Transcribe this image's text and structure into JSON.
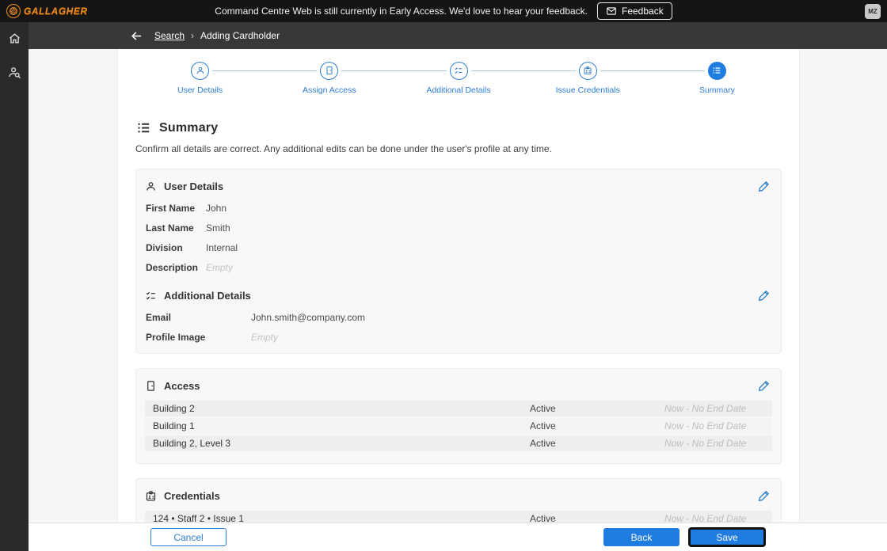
{
  "topbar": {
    "logo_text": "GALLAGHER",
    "message": "Command Centre Web is still currently in Early Access. We'd love to hear your feedback.",
    "feedback_label": "Feedback",
    "user_badge": "MZ"
  },
  "breadcrumb": {
    "back_label": "Search",
    "separator": "›",
    "current": "Adding Cardholder"
  },
  "stepper": {
    "steps": [
      {
        "label": "User Details",
        "icon": "person-icon",
        "state": "done"
      },
      {
        "label": "Assign Access",
        "icon": "door-icon",
        "state": "done"
      },
      {
        "label": "Additional Details",
        "icon": "checklist-icon",
        "state": "done"
      },
      {
        "label": "Issue Credentials",
        "icon": "id-badge-icon",
        "state": "done"
      },
      {
        "label": "Summary",
        "icon": "list-icon",
        "state": "current"
      }
    ]
  },
  "page": {
    "title": "Summary",
    "subtitle": "Confirm all details are correct. Any additional edits can be done under the user's profile at any time."
  },
  "user_details": {
    "title": "User Details",
    "fields": [
      {
        "label": "First Name",
        "value": "John"
      },
      {
        "label": "Last Name",
        "value": "Smith"
      },
      {
        "label": "Division",
        "value": "Internal"
      },
      {
        "label": "Description",
        "value": "Empty"
      }
    ]
  },
  "additional_details": {
    "title": "Additional Details",
    "fields": [
      {
        "label": "Email",
        "value": "John.smith@company.com"
      },
      {
        "label": "Profile Image",
        "value": "Empty"
      }
    ]
  },
  "access": {
    "title": "Access",
    "rows": [
      {
        "name": "Building 2",
        "status": "Active",
        "period": "Now - No End Date"
      },
      {
        "name": "Building 1",
        "status": "Active",
        "period": "Now - No End Date"
      },
      {
        "name": "Building 2, Level 3",
        "status": "Active",
        "period": "Now - No End Date"
      }
    ]
  },
  "credentials": {
    "title": "Credentials",
    "rows": [
      {
        "name": "124 • Staff 2 • Issue 1",
        "status": "Active",
        "period": "Now - No End Date"
      }
    ]
  },
  "footer": {
    "cancel_label": "Cancel",
    "back_label": "Back",
    "save_label": "Save"
  },
  "colors": {
    "accent_blue": "#1f7ce0",
    "logo_orange": "#ee8b1f",
    "topbar_black": "#151515",
    "navbar_gray": "#383838",
    "sidebar_gray": "#2a2a2a"
  }
}
